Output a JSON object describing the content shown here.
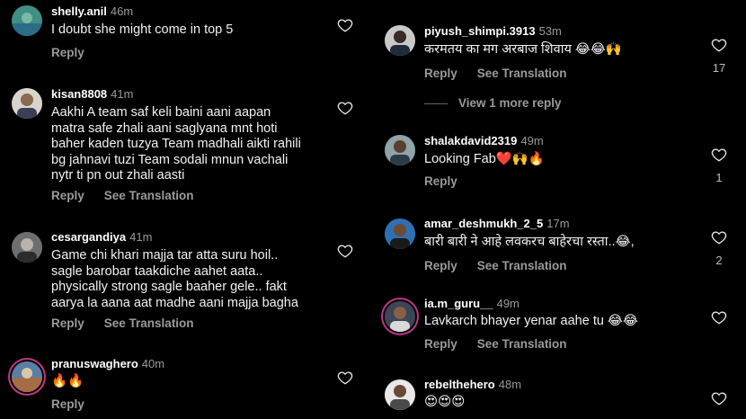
{
  "icons": {
    "heart": "heart-outline-icon"
  },
  "left": [
    {
      "username": "shelly.anil",
      "time": "46m",
      "text": "I doubt she might come in top 5",
      "reply": "Reply",
      "translate": "",
      "likes": ""
    },
    {
      "username": "kisan8808",
      "time": "41m",
      "text": "Aakhi A team saf keli baini aani aapan\nmatra safe zhali aani saglyana mnt hoti\nbaher kaden tuzya Team madhali aikti rahili\nbg jahnavi tuzi Team sodali mnun vachali\nnytr ti pn out zhali aasti",
      "reply": "Reply",
      "translate": "See Translation",
      "likes": ""
    },
    {
      "username": "cesargandiya",
      "time": "41m",
      "text": "Game chi khari majja tar atta suru hoil..\nsagle barobar taakdiche aahet aata..\nphysically strong sagle baaher gele.. fakt\naarya la aana aat madhe aani majja bagha",
      "reply": "Reply",
      "translate": "See Translation",
      "likes": ""
    },
    {
      "username": "pranuswaghero",
      "time": "40m",
      "text": "🔥🔥",
      "reply": "Reply",
      "translate": "",
      "likes": ""
    }
  ],
  "right": [
    {
      "username": "piyush_shimpi.3913",
      "time": "53m",
      "text": "करमतय का मग अरबाज शिवाय 😂😂🙌",
      "reply": "Reply",
      "translate": "See Translation",
      "likes": "17"
    },
    {
      "username": "shalakdavid2319",
      "time": "49m",
      "text": "Looking Fab❤️🙌🔥",
      "reply": "Reply",
      "translate": "",
      "likes": "1"
    },
    {
      "username": "amar_deshmukh_2_5",
      "time": "17m",
      "text": "बारी बारी ने आहे लवकरच बाहेरचा रस्ता..😂,",
      "reply": "Reply",
      "translate": "See Translation",
      "likes": "2"
    },
    {
      "username": "ia.m_guru__",
      "time": "49m",
      "text": "Lavkarch bhayer yenar aahe tu 😂😂",
      "reply": "Reply",
      "translate": "See Translation",
      "likes": ""
    },
    {
      "username": "rebelthehero",
      "time": "48m",
      "text": "😍😍😍",
      "reply": "",
      "translate": "",
      "likes": ""
    }
  ],
  "view_more": "View 1 more reply"
}
